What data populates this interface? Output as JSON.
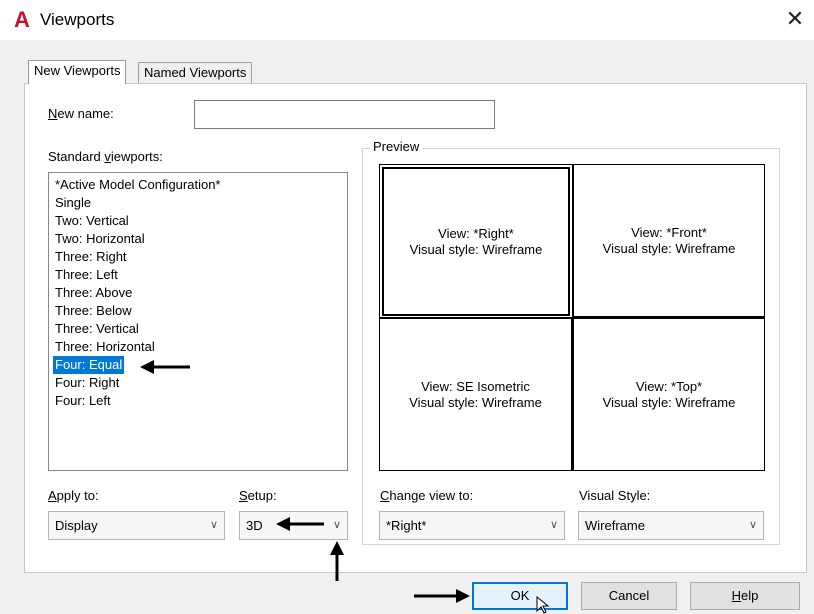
{
  "window": {
    "title": "Viewports",
    "logo": "A",
    "close_icon": "close-icon"
  },
  "tabs": [
    {
      "label": "New Viewports",
      "active": true
    },
    {
      "label": "Named Viewports",
      "active": false
    }
  ],
  "new_name": {
    "label_prefix": "N",
    "label_rest": "ew name:",
    "value": ""
  },
  "standard_viewports": {
    "label_before": "Standard ",
    "label_u": "v",
    "label_after": "iewports:",
    "items": [
      "*Active Model Configuration*",
      "Single",
      "Two:  Vertical",
      "Two:  Horizontal",
      "Three: Right",
      "Three: Left",
      "Three: Above",
      "Three: Below",
      "Three: Vertical",
      "Three: Horizontal",
      "Four: Equal",
      "Four: Right",
      "Four: Left"
    ],
    "selected": "Four: Equal"
  },
  "preview": {
    "title": "Preview",
    "viewports": [
      {
        "view": "View: *Right*",
        "style": "Visual style: Wireframe"
      },
      {
        "view": "View: *Front*",
        "style": "Visual style: Wireframe"
      },
      {
        "view": "View: SE Isometric",
        "style": "Visual style: Wireframe"
      },
      {
        "view": "View: *Top*",
        "style": "Visual style: Wireframe"
      }
    ]
  },
  "apply_to": {
    "label_u": "A",
    "label_rest": "pply to:",
    "value": "Display"
  },
  "setup": {
    "label_u": "S",
    "label_rest": "etup:",
    "value": "3D"
  },
  "change_view_to": {
    "label_u": "C",
    "label_rest": "hange view to:",
    "value": "*Right*"
  },
  "visual_style": {
    "label": "Visual Style:",
    "value": "Wireframe"
  },
  "buttons": {
    "ok": "OK",
    "cancel": "Cancel",
    "help_u": "H",
    "help_rest": "elp"
  },
  "colors": {
    "selection": "#0078d7",
    "logo": "#c8102e",
    "default_button_border": "#0078d7"
  }
}
